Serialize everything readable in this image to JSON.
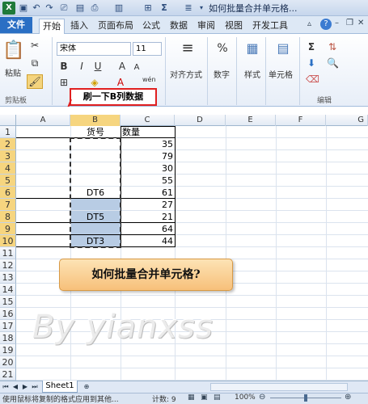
{
  "window": {
    "document_title": "如何批量合并单元格...",
    "quick_access_icons": [
      "excel-logo-icon",
      "save-icon",
      "undo-icon",
      "redo-icon",
      "format-painter-icon",
      "print-icon",
      "border-icon",
      "sum-icon",
      "align-icon"
    ]
  },
  "tabs": [
    "文件",
    "开始",
    "插入",
    "页面布局",
    "公式",
    "数据",
    "审阅",
    "视图",
    "开发工具"
  ],
  "ribbon": {
    "paste_label": "粘贴",
    "clipboard_label": "剪贴板",
    "font_name": "宋体",
    "font_size": "11",
    "bold": "B",
    "italic": "I",
    "underline": "U",
    "wen": "wén",
    "align_label": "对齐方式",
    "number_label": "数字",
    "number_symbol": "%",
    "style_label": "样式",
    "cells_label": "单元格",
    "editing_label": "编辑",
    "sum_symbol": "Σ"
  },
  "callout_text": "刷一下B列数据",
  "columns": [
    "A",
    "B",
    "C",
    "D",
    "E",
    "F",
    "G"
  ],
  "rows": [
    "1",
    "2",
    "3",
    "4",
    "5",
    "6",
    "7",
    "8",
    "9",
    "10",
    "11",
    "12",
    "13",
    "14",
    "15",
    "16",
    "17",
    "18",
    "19",
    "20",
    "21"
  ],
  "cells": {
    "b1": "货号",
    "c1": "数量",
    "c_values": [
      "35",
      "79",
      "30",
      "55",
      "61",
      "27",
      "21",
      "64",
      "44"
    ],
    "b6": "DT6",
    "b8": "DT5",
    "b10": "DT3"
  },
  "banner_text": "如何批量合并单元格?",
  "watermark_text": "By yianxss",
  "sheet_tab": "Sheet1",
  "status": {
    "message": "使用鼠标将复制的格式应用到其他...",
    "count_label": "计数: 9",
    "zoom": "100%"
  },
  "colors": {
    "file_tab": "#2a6fc4",
    "selection_fill": "#b8cce4",
    "header_highlight": "#f6d57f",
    "callout_border": "#e02020",
    "banner_fill": "#f7c07a"
  }
}
